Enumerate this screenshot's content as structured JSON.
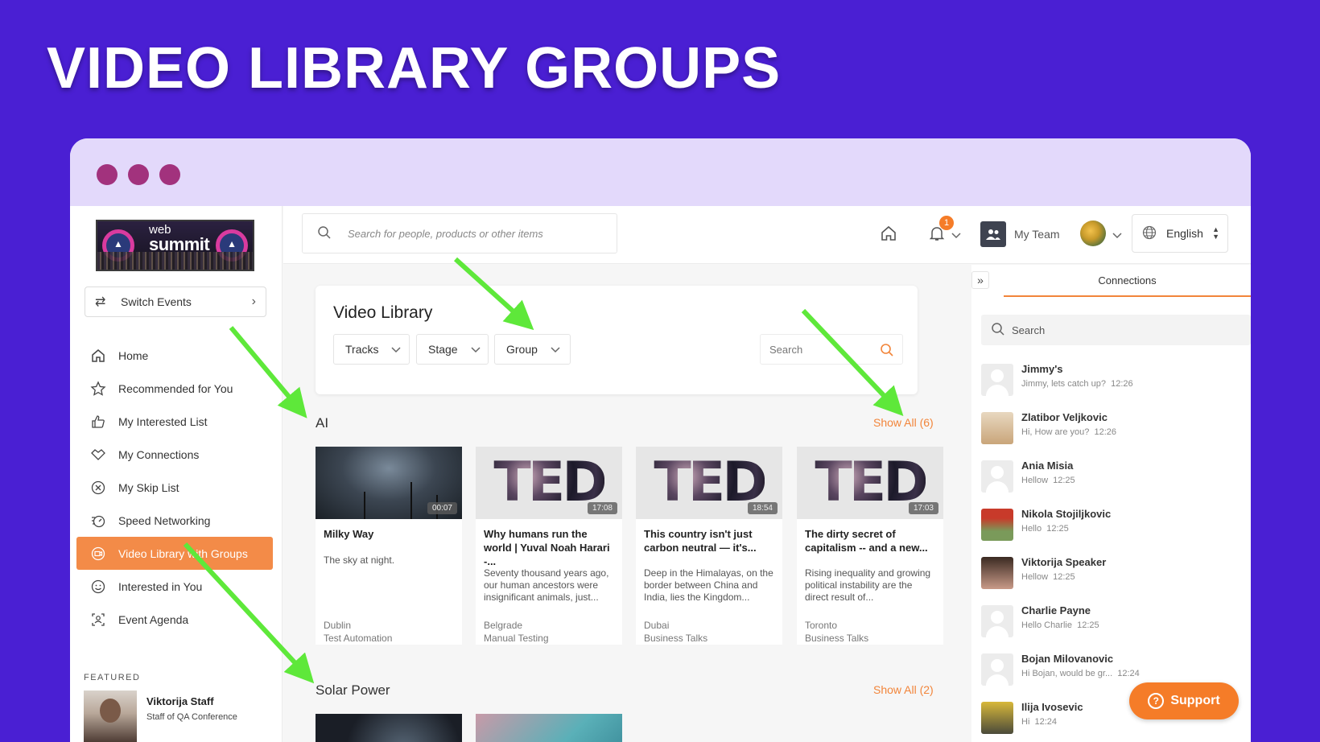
{
  "hero_title": "VIDEO LIBRARY GROUPS",
  "colors": {
    "background": "#4a1fd3",
    "accent": "#f38b48",
    "titlebar": "#e3d9fb",
    "dots": "#a2327d",
    "arrow": "#5ee83a"
  },
  "logo": {
    "line1": "web",
    "line2": "summit"
  },
  "switch_events": {
    "label": "Switch Events",
    "icon": "swap-icon"
  },
  "nav": [
    {
      "label": "Home",
      "icon": "home-icon"
    },
    {
      "label": "Recommended for You",
      "icon": "star-icon"
    },
    {
      "label": "My Interested List",
      "icon": "thumbs-up-icon"
    },
    {
      "label": "My Connections",
      "icon": "handshake-icon"
    },
    {
      "label": "My Skip List",
      "icon": "close-circle-icon"
    },
    {
      "label": "Speed Networking",
      "icon": "speed-icon"
    },
    {
      "label": "Video Library with Groups",
      "icon": "video-icon",
      "active": true
    },
    {
      "label": "Interested in You",
      "icon": "smile-icon"
    },
    {
      "label": "Event Agenda",
      "icon": "agenda-icon"
    }
  ],
  "featured": {
    "heading": "FEATURED",
    "name": "Viktorija Staff",
    "role": "Staff of QA Conference"
  },
  "topbar": {
    "search_placeholder": "Search for people, products or other items",
    "notification_count": "1",
    "team_label": "My Team",
    "language": "English"
  },
  "video_library": {
    "title": "Video Library",
    "filters": [
      "Tracks",
      "Stage",
      "Group"
    ],
    "search_placeholder": "Search"
  },
  "sections": [
    {
      "title": "AI",
      "show_all": "Show All (6)",
      "videos": [
        {
          "title": "Milky Way",
          "desc": "The sky at night.",
          "duration": "00:07",
          "location": "Dublin",
          "track": "Test Automation",
          "thumb": "milky-way"
        },
        {
          "title": "Why humans run the world | Yuval Noah Harari -...",
          "desc": "Seventy thousand years ago, our human ancestors were insignificant animals, just...",
          "duration": "17:08",
          "location": "Belgrade",
          "track": "Manual Testing",
          "thumb": "ted"
        },
        {
          "title": "This country isn't just carbon neutral — it's...",
          "desc": "Deep in the Himalayas, on the border between China and India, lies the Kingdom...",
          "duration": "18:54",
          "location": "Dubai",
          "track": "Business Talks",
          "thumb": "ted"
        },
        {
          "title": "The dirty secret of capitalism -- and a new...",
          "desc": "Rising inequality and growing political instability are the direct result of...",
          "duration": "17:03",
          "location": "Toronto",
          "track": "Business Talks",
          "thumb": "ted"
        }
      ]
    },
    {
      "title": "Solar Power",
      "show_all": "Show All (2)"
    }
  ],
  "ted_text": "TED",
  "connections": {
    "tab": "Connections",
    "search_placeholder": "Search",
    "items": [
      {
        "name": "Jimmy's",
        "msg": "Jimmy, lets catch up?",
        "time": "12:26"
      },
      {
        "name": "Zlatibor Veljkovic",
        "msg": "Hi, How are you?",
        "time": "12:26"
      },
      {
        "name": "Ania Misia",
        "msg": "Hellow",
        "time": "12:25"
      },
      {
        "name": "Nikola Stojiljkovic",
        "msg": "Hello",
        "time": "12:25"
      },
      {
        "name": "Viktorija Speaker",
        "msg": "Hellow",
        "time": "12:25"
      },
      {
        "name": "Charlie Payne",
        "msg": "Hello Charlie",
        "time": "12:25"
      },
      {
        "name": "Bojan Milovanovic",
        "msg": "Hi Bojan, would be gr...",
        "time": "12:24"
      },
      {
        "name": "Ilija Ivosevic",
        "msg": "Hi",
        "time": "12:24"
      }
    ]
  },
  "support": {
    "label": "Support",
    "icon_glyph": "?"
  }
}
